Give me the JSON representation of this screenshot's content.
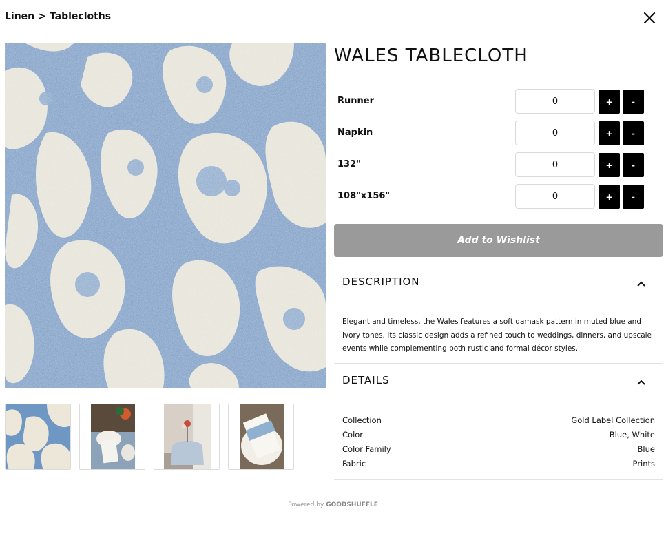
{
  "breadcrumb": {
    "parent": "Linen",
    "separator": ">",
    "current": "Tablecloths"
  },
  "product": {
    "title": "WALES TABLECLOTH"
  },
  "options": [
    {
      "label": "Runner",
      "value": "0",
      "plus": "+",
      "minus": "-"
    },
    {
      "label": "Napkin",
      "value": "0",
      "plus": "+",
      "minus": "-"
    },
    {
      "label": "132\"",
      "value": "0",
      "plus": "+",
      "minus": "-"
    },
    {
      "label": "108\"x156\"",
      "value": "0",
      "plus": "+",
      "minus": "-"
    }
  ],
  "wishlist_label": "Add to Wishlist",
  "description": {
    "title": "DESCRIPTION",
    "text": "Elegant and timeless, the Wales features a soft damask pattern in muted blue and ivory tones. Its classic design adds a refined touch to weddings, dinners, and upscale events while complementing both rustic and formal décor styles."
  },
  "details": {
    "title": "DETAILS",
    "rows": [
      {
        "key": "Collection",
        "value": "Gold Label Collection"
      },
      {
        "key": "Color",
        "value": "Blue, White"
      },
      {
        "key": "Color Family",
        "value": "Blue"
      },
      {
        "key": "Fabric",
        "value": "Prints"
      }
    ]
  },
  "footer": {
    "powered_by": "Powered by",
    "brand": "GOODSHUFFLE"
  },
  "colors": {
    "button": "#000000",
    "wishlist_bg": "#9a9a9a",
    "fabric_blue": "#6b93c0",
    "fabric_ivory": "#ece7d8"
  },
  "icons": {
    "close": "close-icon",
    "collapse": "chevron-up-icon"
  }
}
